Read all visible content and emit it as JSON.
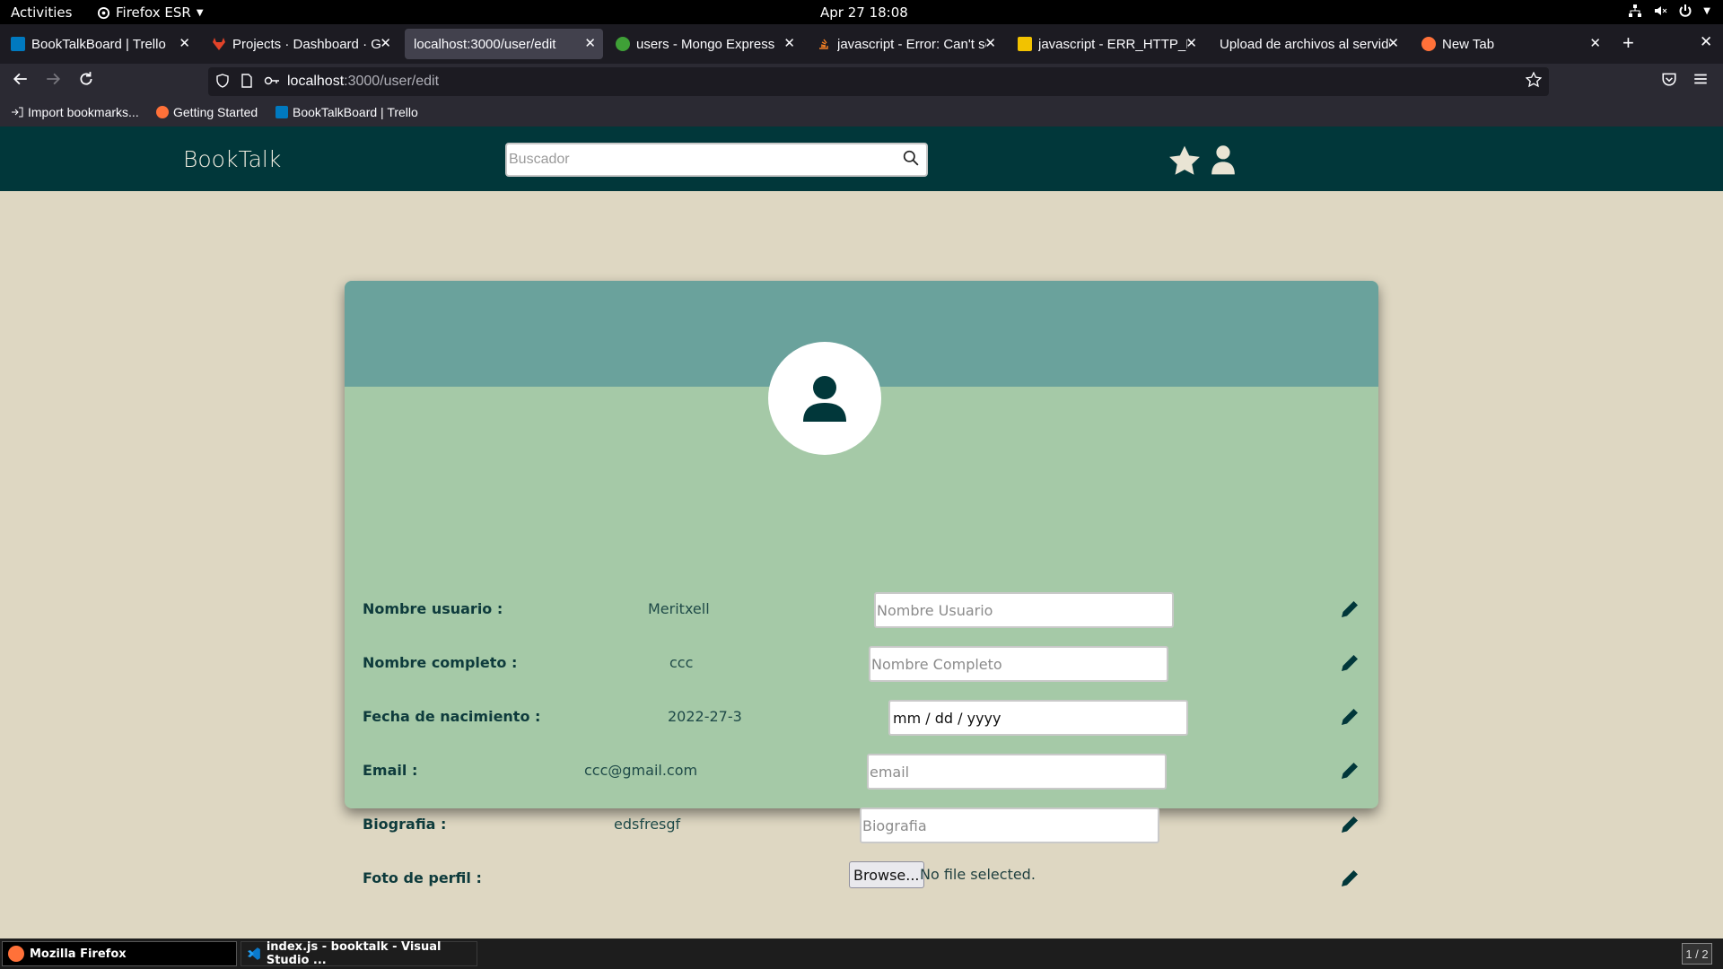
{
  "system": {
    "activities": "Activities",
    "app_menu": "Firefox ESR",
    "clock": "Apr 27  18:08"
  },
  "tabs": [
    {
      "title": "BookTalkBoard | Trello",
      "favicon_color": "#0079bf",
      "active": false
    },
    {
      "title": "Projects · Dashboard · GitLab",
      "favicon_color": "#e24329",
      "active": false
    },
    {
      "title": "localhost:3000/user/edit",
      "favicon_color": "",
      "active": true
    },
    {
      "title": "users - Mongo Express",
      "favicon_color": "#3fa037",
      "active": false
    },
    {
      "title": "javascript - Error: Can't set headers",
      "favicon_color": "#f48024",
      "active": false
    },
    {
      "title": "javascript - ERR_HTTP_HEADERS",
      "favicon_color": "#f2c200",
      "active": false
    },
    {
      "title": "Upload de archivos al servidor",
      "favicon_color": "",
      "active": false
    },
    {
      "title": "New Tab",
      "favicon_color": "#ff7139",
      "active": false
    }
  ],
  "urlbar": {
    "host": "localhost",
    "path": ":3000/user/edit"
  },
  "bookmarks": [
    {
      "label": "Import bookmarks...",
      "icon": "import-icon"
    },
    {
      "label": "Getting Started",
      "icon": "firefox-icon"
    },
    {
      "label": "BookTalkBoard | Trello",
      "icon": "trello-icon"
    }
  ],
  "app": {
    "brand": "BookTalk",
    "search_placeholder": "Buscador",
    "colors": {
      "header": "#01373a",
      "page_bg": "#ded7c2",
      "card": "#a5c9a7",
      "banner": "#6aa29c"
    }
  },
  "profile": {
    "fields": [
      {
        "label": "Nombre usuario :",
        "value": "Meritxell",
        "placeholder": "Nombre Usuario",
        "kind": "text"
      },
      {
        "label": "Nombre completo :",
        "value": "ccc",
        "placeholder": "Nombre Completo",
        "kind": "text"
      },
      {
        "label": "Fecha de nacimiento :",
        "value": "2022-27-3",
        "placeholder": "mm / dd / yyyy",
        "kind": "date"
      },
      {
        "label": "Email :",
        "value": "ccc@gmail.com",
        "placeholder": "email",
        "kind": "text"
      },
      {
        "label": "Biografia :",
        "value": "edsfresgf",
        "placeholder": "Biografia",
        "kind": "text"
      },
      {
        "label": "Foto de perfil :",
        "value": "",
        "kind": "file",
        "browse_label": "Browse...",
        "file_status": "No file selected."
      }
    ]
  },
  "taskbar": {
    "items": [
      {
        "label": "Mozilla Firefox",
        "active": true
      },
      {
        "label": "index.js - booktalk - Visual Studio ...",
        "active": false
      }
    ],
    "pager": "1 / 2"
  }
}
